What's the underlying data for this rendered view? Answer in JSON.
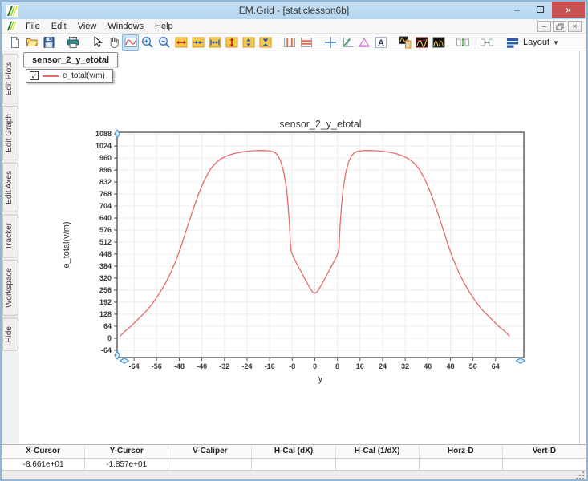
{
  "window": {
    "title": "EM.Grid - [staticlesson6b]"
  },
  "menubar": {
    "items": [
      {
        "label": "File",
        "key": "F"
      },
      {
        "label": "Edit",
        "key": "E"
      },
      {
        "label": "View",
        "key": "V"
      },
      {
        "label": "Windows",
        "key": "W"
      },
      {
        "label": "Help",
        "key": "H"
      }
    ]
  },
  "toolbar": {
    "buttons": [
      {
        "name": "new-file"
      },
      {
        "name": "open-file"
      },
      {
        "name": "save-file"
      },
      {
        "name": "print",
        "gap_before": true
      },
      {
        "name": "select-cursor",
        "gap_before": true
      },
      {
        "name": "pan-hand"
      },
      {
        "name": "zoom-curve",
        "selected": true
      },
      {
        "name": "zoom-in"
      },
      {
        "name": "zoom-out"
      },
      {
        "name": "expand-x"
      },
      {
        "name": "compress-x"
      },
      {
        "name": "fit-x"
      },
      {
        "name": "expand-y"
      },
      {
        "name": "compress-y"
      },
      {
        "name": "fit-y"
      },
      {
        "name": "caliper-vertical",
        "gap_before": true
      },
      {
        "name": "caliper-horizontal"
      },
      {
        "name": "crosshair",
        "gap_before": true
      },
      {
        "name": "tracker"
      },
      {
        "name": "delta-marker"
      },
      {
        "name": "add-text"
      },
      {
        "name": "copy-plot",
        "gap_before": true
      },
      {
        "name": "fft"
      },
      {
        "name": "inverse-fft"
      },
      {
        "name": "autoscale-vertical",
        "gap_before": true
      },
      {
        "name": "autoscale-horizontal",
        "gap_before": true
      }
    ],
    "layout_button": {
      "label": "Layout"
    }
  },
  "sidebar": {
    "tabs": [
      {
        "label": "Edit Plots"
      },
      {
        "label": "Edit Graph"
      },
      {
        "label": "Edit Axes"
      },
      {
        "label": "Tracker"
      },
      {
        "label": "Workspace"
      },
      {
        "label": "Hide"
      }
    ]
  },
  "doc_tabs": [
    {
      "label": "sensor_2_y_etotal",
      "active": true
    }
  ],
  "legend": {
    "checked": true,
    "series_label": "e_total(v/m)"
  },
  "chart_data": {
    "type": "line",
    "title": "sensor_2_y_etotal",
    "xlabel": "y",
    "ylabel": "e_total(v/m)",
    "xlim": [
      -70,
      74
    ],
    "ylim": [
      -103,
      1097
    ],
    "xticks": [
      -64,
      -56,
      -48,
      -40,
      -32,
      -24,
      -16,
      -8,
      0,
      8,
      16,
      24,
      32,
      40,
      48,
      56,
      64
    ],
    "yticks": [
      1088,
      1024,
      960,
      896,
      832,
      768,
      704,
      640,
      576,
      512,
      448,
      384,
      320,
      256,
      192,
      128,
      64,
      0,
      -64
    ],
    "grid": true,
    "legend_position": "top-left-floating",
    "line_color": "#e96a6a",
    "series": [
      {
        "name": "e_total(v/m)",
        "points": [
          [
            -69,
            10
          ],
          [
            -67,
            40
          ],
          [
            -65,
            65
          ],
          [
            -63,
            95
          ],
          [
            -61,
            125
          ],
          [
            -59,
            155
          ],
          [
            -57,
            195
          ],
          [
            -55,
            240
          ],
          [
            -53,
            290
          ],
          [
            -51,
            350
          ],
          [
            -49,
            420
          ],
          [
            -47,
            505
          ],
          [
            -45,
            600
          ],
          [
            -43,
            690
          ],
          [
            -41,
            775
          ],
          [
            -39,
            845
          ],
          [
            -37,
            900
          ],
          [
            -35,
            935
          ],
          [
            -33,
            958
          ],
          [
            -31,
            972
          ],
          [
            -29,
            982
          ],
          [
            -27,
            989
          ],
          [
            -25,
            994
          ],
          [
            -23,
            997
          ],
          [
            -21,
            999
          ],
          [
            -19,
            1000
          ],
          [
            -17,
            999
          ],
          [
            -15,
            995
          ],
          [
            -14,
            988
          ],
          [
            -13,
            972
          ],
          [
            -12,
            940
          ],
          [
            -11,
            885
          ],
          [
            -10,
            795
          ],
          [
            -9.5,
            715
          ],
          [
            -9,
            610
          ],
          [
            -8.6,
            490
          ],
          [
            -8.3,
            460
          ],
          [
            -7.5,
            430
          ],
          [
            -6.5,
            400
          ],
          [
            -5.5,
            372
          ],
          [
            -4.5,
            345
          ],
          [
            -3.5,
            316
          ],
          [
            -2.5,
            288
          ],
          [
            -1.5,
            262
          ],
          [
            -0.8,
            246
          ],
          [
            0,
            240
          ],
          [
            0.8,
            246
          ],
          [
            1.5,
            262
          ],
          [
            2.5,
            288
          ],
          [
            3.5,
            316
          ],
          [
            4.5,
            345
          ],
          [
            5.5,
            372
          ],
          [
            6.5,
            400
          ],
          [
            7.5,
            430
          ],
          [
            8.3,
            460
          ],
          [
            8.6,
            490
          ],
          [
            9,
            610
          ],
          [
            9.5,
            715
          ],
          [
            10,
            795
          ],
          [
            11,
            885
          ],
          [
            12,
            940
          ],
          [
            13,
            972
          ],
          [
            14,
            988
          ],
          [
            15,
            995
          ],
          [
            17,
            999
          ],
          [
            19,
            1000
          ],
          [
            21,
            999
          ],
          [
            23,
            997
          ],
          [
            25,
            994
          ],
          [
            27,
            989
          ],
          [
            29,
            982
          ],
          [
            31,
            972
          ],
          [
            33,
            958
          ],
          [
            35,
            935
          ],
          [
            37,
            900
          ],
          [
            39,
            845
          ],
          [
            41,
            775
          ],
          [
            43,
            690
          ],
          [
            45,
            600
          ],
          [
            47,
            505
          ],
          [
            49,
            420
          ],
          [
            51,
            350
          ],
          [
            53,
            290
          ],
          [
            55,
            240
          ],
          [
            57,
            195
          ],
          [
            59,
            155
          ],
          [
            61,
            125
          ],
          [
            63,
            95
          ],
          [
            65,
            65
          ],
          [
            67,
            40
          ],
          [
            69,
            10
          ]
        ]
      }
    ]
  },
  "statusbar": {
    "columns": [
      {
        "label": "X-Cursor",
        "value": "-8.661e+01"
      },
      {
        "label": "Y-Cursor",
        "value": "-1.857e+01"
      },
      {
        "label": "V-Caliper",
        "value": ""
      },
      {
        "label": "H-Cal (dX)",
        "value": ""
      },
      {
        "label": "H-Cal (1/dX)",
        "value": ""
      },
      {
        "label": "Horz-D",
        "value": ""
      },
      {
        "label": "Vert-D",
        "value": ""
      }
    ]
  },
  "colors": {
    "titlebar_blue": "#b5d6ef",
    "close_red": "#c85050",
    "curve_red": "#e96a6a",
    "toolbar_yellow": "#f7c948",
    "handle_blue": "#3f8fcc",
    "grid_gray": "#ececec",
    "plot_border": "#6e6e6e"
  }
}
